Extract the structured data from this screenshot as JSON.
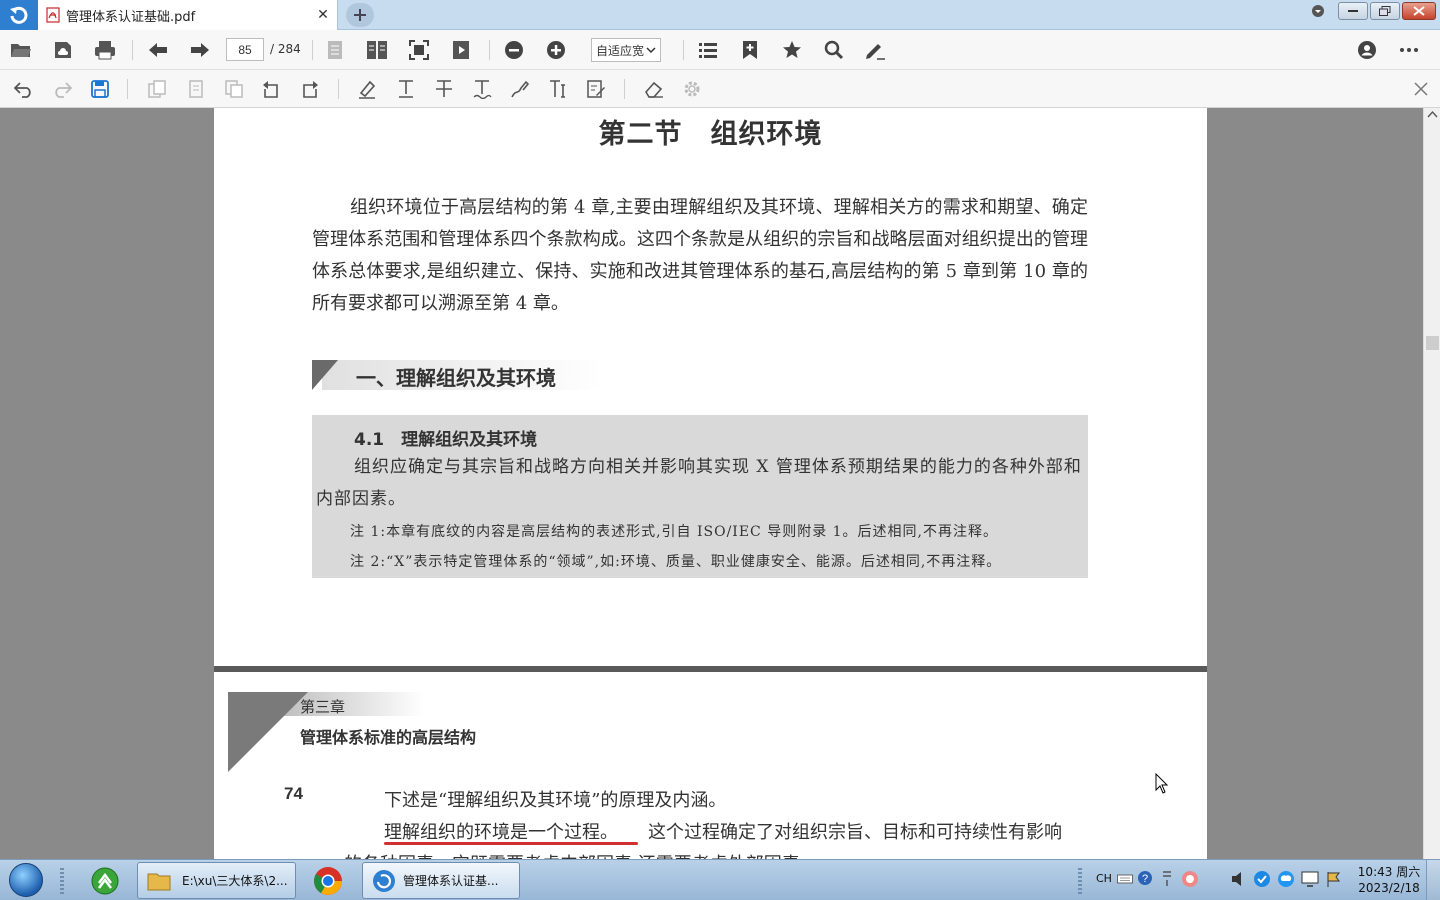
{
  "tab": {
    "title": "管理体系认证基础.pdf",
    "close": "✕"
  },
  "toolbar": {
    "page_current": "85",
    "page_total": "/ 284",
    "zoom_label": "自适应宽"
  },
  "document": {
    "section_title": "第二节　组织环境",
    "intro_paragraph": "组织环境位于高层结构的第 4 章,主要由理解组织及其环境、理解相关方的需求和期望、确定管理体系范围和管理体系四个条款构成。这四个条款是从组织的宗旨和战略层面对组织提出的管理体系总体要求,是组织建立、保持、实施和改进其管理体系的基石,高层结构的第 5 章到第 10 章的所有要求都可以溯源至第 4 章。",
    "heading_1": "一、理解组织及其环境",
    "box": {
      "title": "4.1　理解组织及其环境",
      "body": "组织应确定与其宗旨和战略方向相关并影响其实现 X 管理体系预期结果的能力的各种外部和内部因素。",
      "note1": "注 1:本章有底纹的内容是高层结构的表述形式,引自 ISO/IEC 导则附录 1。后述相同,不再注释。",
      "note2": "注 2:“X”表示特定管理体系的“领域”,如:环境、质量、职业健康安全、能源。后述相同,不再注释。"
    },
    "page2": {
      "chapter_label": "第三章",
      "chapter_subtitle": "管理体系标准的高层结构",
      "page_number": "74",
      "line1": "下述是“理解组织及其环境”的原理及内涵。",
      "line2_underlined": "理解组织的环境是一个过程。",
      "line2_rest": "这个过程确定了对组织宗旨、目标和可持续性有影响",
      "line3": "的各种因素。它既需要考虑内部因素,还需要考虑外部因素"
    }
  },
  "taskbar": {
    "explorer_task": "E:\\xu\\三大体系\\2...",
    "pdf_task": "管理体系认证基...",
    "tray_lang": "CH",
    "clock_time": "10:43 周六",
    "clock_date": "2023/2/18"
  },
  "colors": {
    "accent_blue": "#2f7fd1",
    "tab_bar": "#c7dcef",
    "viewer_bg": "#8a8a8a",
    "underline_red": "#d03030"
  }
}
